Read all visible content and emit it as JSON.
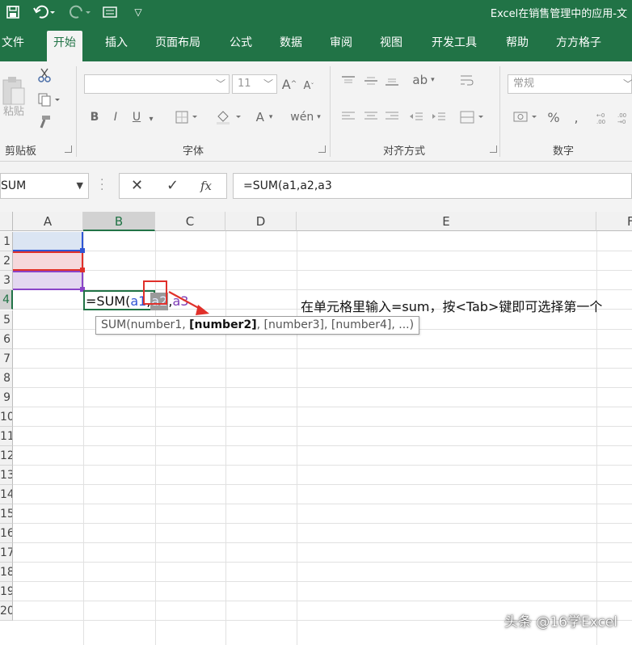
{
  "window": {
    "title": "Excel在销售管理中的应用-文"
  },
  "quick_access": {
    "save_icon": "save-icon",
    "undo_icon": "undo-icon",
    "redo_icon": "redo-icon",
    "customize_icon": "customize-icon"
  },
  "tabs": [
    {
      "label": "文件",
      "active": false
    },
    {
      "label": "开始",
      "active": true
    },
    {
      "label": "插入",
      "active": false
    },
    {
      "label": "页面布局",
      "active": false
    },
    {
      "label": "公式",
      "active": false
    },
    {
      "label": "数据",
      "active": false
    },
    {
      "label": "审阅",
      "active": false
    },
    {
      "label": "视图",
      "active": false
    },
    {
      "label": "开发工具",
      "active": false
    },
    {
      "label": "帮助",
      "active": false
    },
    {
      "label": "方方格子",
      "active": false
    }
  ],
  "ribbon": {
    "clipboard": {
      "label": "剪贴板",
      "paste_label": "粘贴"
    },
    "font": {
      "label": "字体",
      "font_name": "",
      "font_size": "11",
      "bold": "B",
      "italic": "I",
      "underline": "U"
    },
    "alignment": {
      "label": "对齐方式"
    },
    "number": {
      "label": "数字",
      "format": "常规",
      "percent": "%"
    }
  },
  "formula_bar": {
    "name_box": "SUM",
    "cancel_glyph": "✕",
    "enter_glyph": "✓",
    "fx_glyph": "fx",
    "formula": "=SUM(a1,a2,a3"
  },
  "grid": {
    "columns": [
      "A",
      "B",
      "C",
      "D",
      "E",
      "F"
    ],
    "selected_column": "B",
    "row_labels": [
      "1",
      "2",
      "3",
      "4",
      "5",
      "6",
      "7",
      "8",
      "9",
      "10",
      "11",
      "12",
      "13",
      "14",
      "15",
      "16",
      "17",
      "18",
      "19",
      "20"
    ],
    "selected_row": "4",
    "editing_cell": {
      "tokens": [
        "=SUM(",
        "a1",
        ",",
        "a2",
        ",",
        "a3"
      ]
    },
    "tooltip": {
      "prefix": "SUM(number1, ",
      "bold": "[number2]",
      "rest": ", [number3], [number4], ...)"
    },
    "annotation": "在单元格里输入=sum，按<Tab>键即可选择第一个"
  },
  "colors": {
    "excel_green": "#217346",
    "ref1_blue": "#2f55d4",
    "ref2_red": "#e0302a",
    "ref3_purple": "#8a44c8",
    "annotation_red": "#e0302a"
  },
  "watermark": "头条 @16学Excel"
}
